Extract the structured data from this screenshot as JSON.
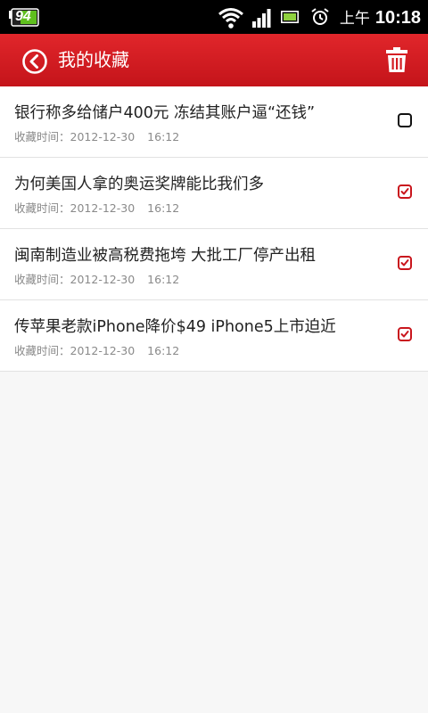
{
  "status_bar": {
    "battery_level_text": "94",
    "time_period": "上午",
    "time": "10:18",
    "icons": [
      "battery-charging-icon",
      "wifi-icon",
      "signal-icon",
      "battery-icon",
      "alarm-icon"
    ]
  },
  "header": {
    "title": "我的收藏",
    "back_icon": "back-icon",
    "delete_icon": "trash-icon"
  },
  "colors": {
    "accent": "#d31c22",
    "check": "#c9161d"
  },
  "favorites": [
    {
      "title": "银行称多给储户400元 冻结其账户逼“还钱”",
      "meta_label": "收藏时间：",
      "date": "2012-12-30",
      "time": "16:12",
      "checked": false
    },
    {
      "title": "为何美国人拿的奥运奖牌能比我们多",
      "meta_label": "收藏时间：",
      "date": "2012-12-30",
      "time": "16:12",
      "checked": true
    },
    {
      "title": "闽南制造业被高税费拖垮 大批工厂停产出租",
      "meta_label": "收藏时间：",
      "date": "2012-12-30",
      "time": "16:12",
      "checked": true
    },
    {
      "title": "传苹果老款iPhone降价$49 iPhone5上市迫近",
      "meta_label": "收藏时间：",
      "date": "2012-12-30",
      "time": "16:12",
      "checked": true
    }
  ]
}
